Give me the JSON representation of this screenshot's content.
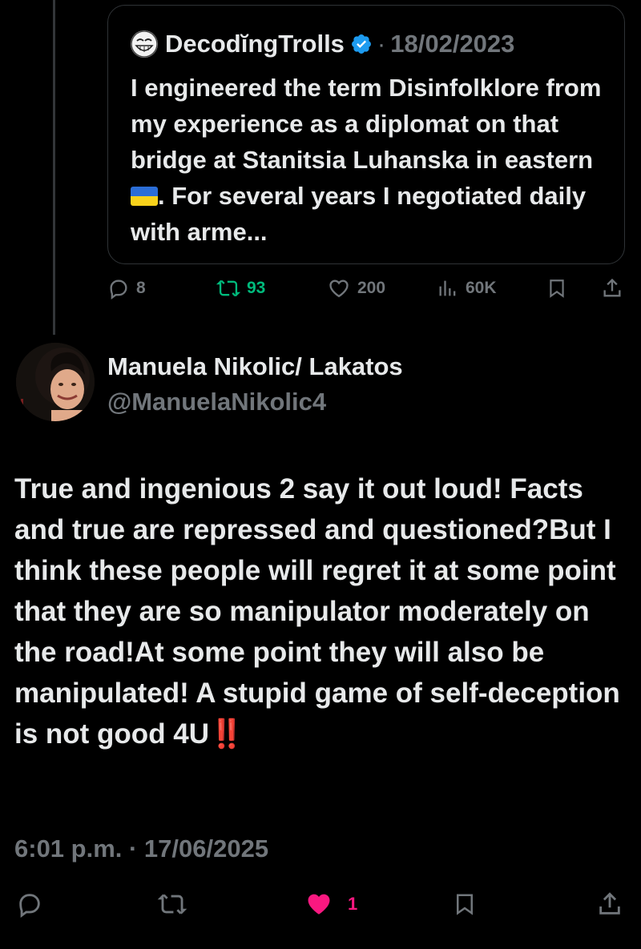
{
  "quoted_tweet": {
    "author_name": "DecodĭngTrolls",
    "separator": "·",
    "date": "18/02/2023",
    "text_before_flag": "I engineered the term Disinfolklore from my experience as a diplomat on that bridge at Stanitsia Luhanska in eastern ",
    "flag_icon": "ukraine-flag-icon",
    "text_after_flag": ". For several years I negotiated daily with arme...",
    "stats": {
      "replies": "8",
      "reposts": "93",
      "likes": "200",
      "views": "60K"
    }
  },
  "tweet": {
    "author_name": "Manuela Nikolic/ Lakatos",
    "handle": "@ManuelaNikolic4",
    "text": "True and ingenious 2 say it out loud! Facts and true are repressed and questioned?But I think these people will regret it at some point that they are so manipulator moderately on the road!At some point they will also be manipulated! A stupid game of self-deception is not good 4U",
    "text_emoji": "‼️",
    "timestamp": "6:01 p.m. · 17/06/2025",
    "like_count": "1"
  },
  "colors": {
    "background": "#000000",
    "text": "#e7e9ea",
    "muted": "#71767b",
    "repost_green": "#00ba7c",
    "like_pink": "#f91880",
    "verified_blue": "#1d9bf0"
  }
}
